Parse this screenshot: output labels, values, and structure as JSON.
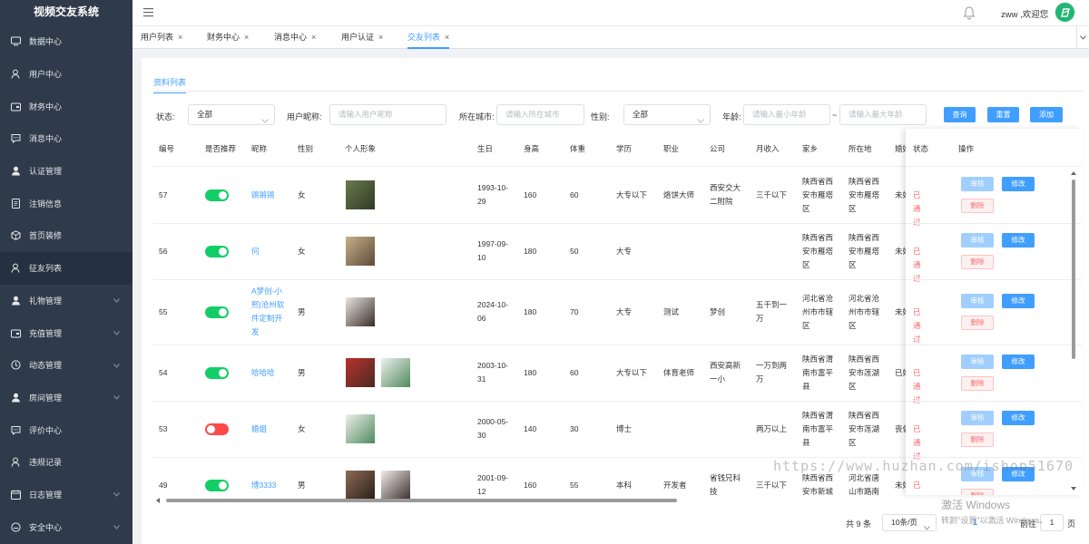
{
  "app": {
    "title": "视频交友系统"
  },
  "sidebar": {
    "items": [
      {
        "label": "数据中心",
        "icon": "monitor-icon"
      },
      {
        "label": "用户中心",
        "icon": "user-icon"
      },
      {
        "label": "财务中心",
        "icon": "wallet-icon"
      },
      {
        "label": "消息中心",
        "icon": "message-icon"
      },
      {
        "label": "认证管理",
        "icon": "user-solid-icon"
      },
      {
        "label": "注销信息",
        "icon": "document-icon"
      },
      {
        "label": "首页装修",
        "icon": "box-icon"
      },
      {
        "label": "征友列表",
        "icon": "user-icon",
        "active": true
      },
      {
        "label": "礼物管理",
        "icon": "user-solid-icon",
        "arrow": true
      },
      {
        "label": "充值管理",
        "icon": "wallet-icon",
        "arrow": true
      },
      {
        "label": "动态管理",
        "icon": "clock-icon",
        "arrow": true
      },
      {
        "label": "房间管理",
        "icon": "user-solid-icon",
        "arrow": true
      },
      {
        "label": "评价中心",
        "icon": "message-icon"
      },
      {
        "label": "违规记录",
        "icon": "user-icon"
      },
      {
        "label": "日志管理",
        "icon": "calendar-icon",
        "arrow": true
      },
      {
        "label": "安全中心",
        "icon": "shield-icon",
        "arrow": true
      }
    ]
  },
  "header": {
    "welcome": "zww ,欢迎您"
  },
  "tabs": [
    {
      "label": "用户列表"
    },
    {
      "label": "财务中心"
    },
    {
      "label": "消息中心"
    },
    {
      "label": "用户认证"
    },
    {
      "label": "交友列表",
      "active": true
    }
  ],
  "card": {
    "tab": "资料列表"
  },
  "filters": {
    "status_label": "状态:",
    "status_value": "全部",
    "nickname_label": "用户昵称:",
    "nickname_placeholder": "请输入用户昵称",
    "city_label": "所在城市:",
    "city_placeholder": "请输入所在城市",
    "gender_label": "性别:",
    "gender_value": "全部",
    "age_label": "年龄:",
    "age_min_placeholder": "请输入最小年龄",
    "age_sep": "~",
    "age_max_placeholder": "请输入最大年龄",
    "query": "查询",
    "reset": "重置",
    "add": "添加"
  },
  "table": {
    "headers": [
      "编号",
      "是否推荐",
      "昵称",
      "性别",
      "个人形象",
      "生日",
      "身高",
      "体重",
      "学历",
      "职业",
      "公司",
      "月收入",
      "家乡",
      "所在地",
      "婚姻"
    ],
    "fixed_headers": [
      "状态",
      "操作"
    ],
    "rows": [
      {
        "id": "57",
        "recommend": true,
        "nickname": [
          "锵锵锵"
        ],
        "gender": "女",
        "images": [
          {
            "c1": "#6b7a4e",
            "c2": "#2f3a25"
          }
        ],
        "birthday": [
          "1993-10-",
          "29"
        ],
        "height": "160",
        "weight": "60",
        "education": "大专以下",
        "job": [
          "烙饼大师"
        ],
        "company": [
          "西安交大",
          "二附院"
        ],
        "income": [
          "三千以下"
        ],
        "hometown": [
          "陕西省西",
          "安市雁塔",
          "区"
        ],
        "location": [
          "陕西省西",
          "安市雁塔",
          "区"
        ],
        "marital": "未婚",
        "status": "已通过"
      },
      {
        "id": "56",
        "recommend": true,
        "nickname": [
          "何"
        ],
        "gender": "女",
        "images": [
          {
            "c1": "#c9b08a",
            "c2": "#5b4a38"
          }
        ],
        "birthday": [
          "1997-09-",
          "10"
        ],
        "height": "180",
        "weight": "50",
        "education": "大专",
        "job": [],
        "company": [],
        "income": [],
        "hometown": [
          "陕西省西",
          "安市雁塔",
          "区"
        ],
        "location": [
          "陕西省西",
          "安市雁塔",
          "区"
        ],
        "marital": "未婚",
        "status": "已通过"
      },
      {
        "id": "55",
        "recommend": true,
        "nickname": [
          "A梦创-小",
          "熙|沧州软",
          "件定制开",
          "发"
        ],
        "gender": "男",
        "images": [
          {
            "c1": "#e9e6e2",
            "c2": "#3a2c28"
          }
        ],
        "birthday": [
          "2024-10-",
          "06"
        ],
        "height": "180",
        "weight": "70",
        "education": "大专",
        "job": [
          "测试"
        ],
        "company": [
          "梦创"
        ],
        "income": [
          "五千到一",
          "万"
        ],
        "hometown": [
          "河北省沧",
          "州市市辖",
          "区"
        ],
        "location": [
          "河北省沧",
          "州市市辖",
          "区"
        ],
        "marital": "未婚",
        "status": "已通过"
      },
      {
        "id": "54",
        "recommend": true,
        "nickname": [
          "哈哈哈"
        ],
        "gender": "男",
        "images": [
          {
            "c1": "#b8322d",
            "c2": "#4a2a22"
          },
          {
            "c1": "#eef0ec",
            "c2": "#4f8a5e"
          }
        ],
        "birthday": [
          "2003-10-",
          "31"
        ],
        "height": "180",
        "weight": "60",
        "education": "大专以下",
        "job": [
          "体育老师"
        ],
        "company": [
          "西安高新",
          "一小"
        ],
        "income": [
          "一万到两",
          "万"
        ],
        "hometown": [
          "陕西省渭",
          "南市富平",
          "县"
        ],
        "location": [
          "陕西省西",
          "安市莲湖",
          "区"
        ],
        "marital": "已婚",
        "status": "已通过"
      },
      {
        "id": "53",
        "recommend": false,
        "nickname": [
          "婚姐"
        ],
        "gender": "女",
        "images": [
          {
            "c1": "#eef0ec",
            "c2": "#4f8a5e"
          }
        ],
        "birthday": [
          "2000-05-",
          "30"
        ],
        "height": "140",
        "weight": "30",
        "education": "博士",
        "job": [],
        "company": [],
        "income": [
          "两万以上"
        ],
        "hometown": [
          "陕西省渭",
          "南市富平",
          "县"
        ],
        "location": [
          "陕西省西",
          "安市莲湖",
          "区"
        ],
        "marital": "丧偶",
        "status": "已通过"
      },
      {
        "id": "49",
        "recommend": true,
        "nickname": [
          "博3333"
        ],
        "gender": "男",
        "images": [
          {
            "c1": "#8d6b55",
            "c2": "#2a1e18"
          },
          {
            "c1": "#f2ece8",
            "c2": "#3b2f2f"
          }
        ],
        "birthday": [
          "2001-09-",
          "12"
        ],
        "height": "160",
        "weight": "55",
        "education": "本科",
        "job": [
          "开发者"
        ],
        "company": [
          "省钱兄科",
          "技"
        ],
        "income": [
          "三千以下"
        ],
        "hometown": [
          "陕西省西",
          "安市新城"
        ],
        "location": [
          "河北省唐",
          "山市路南"
        ],
        "marital": "未婚",
        "status": "已通过"
      }
    ],
    "actions": {
      "audit": "审核",
      "edit": "修改",
      "delete": "删除"
    }
  },
  "pagination": {
    "total": "共 9 条",
    "page_size": "10条/页",
    "current": "1",
    "goto": "前往",
    "goto_value": "1",
    "page_unit": "页"
  },
  "overlay": {
    "watermark": "https://www.huzhan.com/ishop51670",
    "activate_title": "激活 Windows",
    "activate_sub": "转到\"设置\"以激活 Windows。"
  }
}
